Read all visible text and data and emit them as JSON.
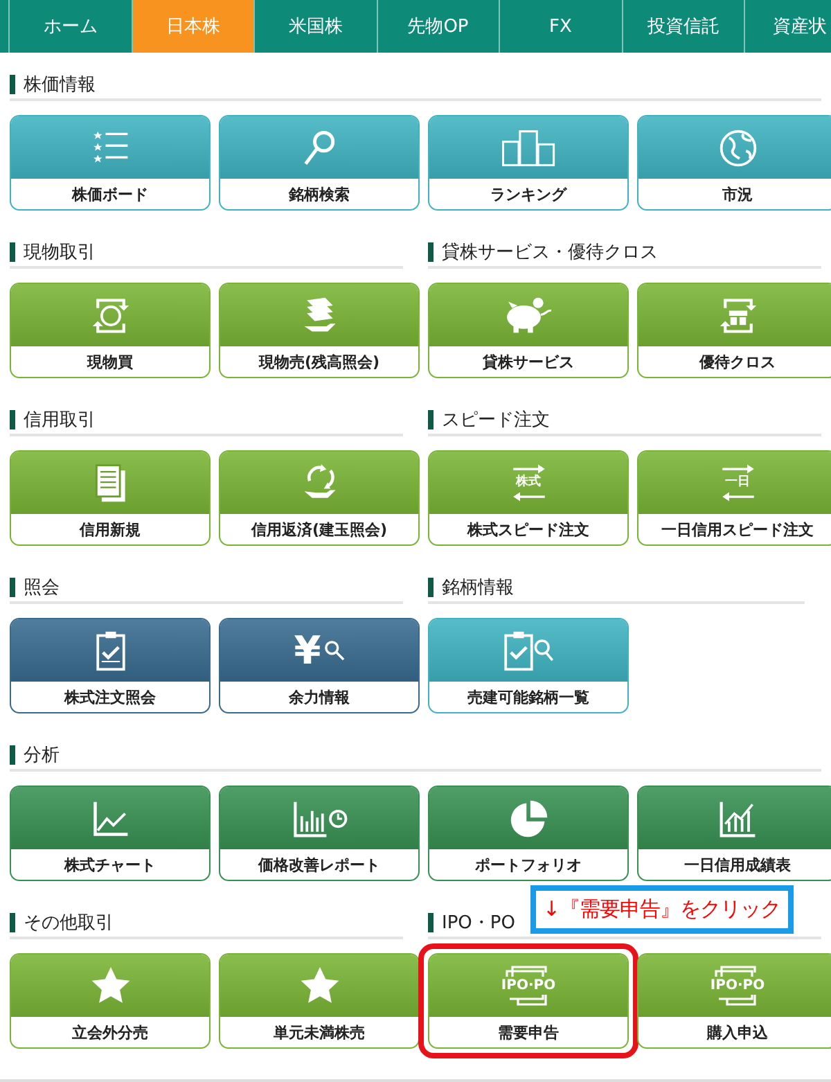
{
  "nav": {
    "tabs": [
      {
        "label": "ホーム",
        "selected": false
      },
      {
        "label": "日本株",
        "selected": true
      },
      {
        "label": "米国株",
        "selected": false
      },
      {
        "label": "先物OP",
        "selected": false
      },
      {
        "label": "FX",
        "selected": false
      },
      {
        "label": "投資信託",
        "selected": false
      },
      {
        "label": "資産状",
        "selected": false
      }
    ]
  },
  "rows": [
    {
      "sections": [
        {
          "title": "株価情報",
          "tiles": [
            {
              "label": "株価ボード",
              "color": "#3fb3c1",
              "kind": "starlist",
              "highlighted": false
            },
            {
              "label": "銘柄検索",
              "color": "#3fb3c1",
              "kind": "search",
              "highlighted": false
            },
            {
              "label": "ランキング",
              "color": "#3fb3c1",
              "kind": "podium",
              "highlighted": false
            },
            {
              "label": "市況",
              "color": "#3fb3c1",
              "kind": "globe",
              "highlighted": false
            }
          ]
        }
      ]
    },
    {
      "sections": [
        {
          "title": "現物取引",
          "tiles": [
            {
              "label": "現物買",
              "color": "#79b535",
              "kind": "cycle",
              "highlighted": false
            },
            {
              "label": "現物売(残高照会)",
              "color": "#79b535",
              "kind": "cash",
              "highlighted": false
            }
          ]
        },
        {
          "title": "貸株サービス・優待クロス",
          "tiles": [
            {
              "label": "貸株サービス",
              "color": "#79b535",
              "kind": "piggy",
              "highlighted": false
            },
            {
              "label": "優待クロス",
              "color": "#79b535",
              "kind": "gift",
              "highlighted": false
            }
          ]
        }
      ]
    },
    {
      "sections": [
        {
          "title": "信用取引",
          "tiles": [
            {
              "label": "信用新規",
              "color": "#79b535",
              "kind": "document",
              "highlighted": false
            },
            {
              "label": "信用返済(建玉照会)",
              "color": "#79b535",
              "kind": "return",
              "highlighted": false
            }
          ]
        },
        {
          "title": "スピード注文",
          "tiles": [
            {
              "label": "株式スピード注文",
              "color": "#79b535",
              "kind": "swap",
              "icon_text": "株式",
              "highlighted": false
            },
            {
              "label": "一日信用スピード注文",
              "color": "#79b535",
              "kind": "swap",
              "icon_text": "一日",
              "highlighted": false
            }
          ]
        }
      ]
    },
    {
      "sections": [
        {
          "title": "照会",
          "tiles": [
            {
              "label": "株式注文照会",
              "color": "#386b8f",
              "kind": "clipboard",
              "highlighted": false
            },
            {
              "label": "余力情報",
              "color": "#386b8f",
              "kind": "yen",
              "icon_text": "¥",
              "highlighted": false
            }
          ]
        },
        {
          "title": "銘柄情報",
          "tiles": [
            {
              "label": "売建可能銘柄一覧",
              "color": "#3fb3c1",
              "kind": "clipsearch",
              "highlighted": false
            }
          ]
        }
      ]
    },
    {
      "sections": [
        {
          "title": "分析",
          "tiles": [
            {
              "label": "株式チャート",
              "color": "#379152",
              "kind": "line",
              "highlighted": false
            },
            {
              "label": "価格改善レポート",
              "color": "#379152",
              "kind": "barclock",
              "highlighted": false
            },
            {
              "label": "ポートフォリオ",
              "color": "#379152",
              "kind": "pie",
              "highlighted": false
            },
            {
              "label": "一日信用成績表",
              "color": "#379152",
              "kind": "barup",
              "highlighted": false
            }
          ]
        }
      ]
    },
    {
      "sections": [
        {
          "title": "その他取引",
          "tiles": [
            {
              "label": "立会外分売",
              "color": "#79b535",
              "kind": "star",
              "highlighted": false
            },
            {
              "label": "単元未満株売",
              "color": "#79b535",
              "kind": "star",
              "highlighted": false
            }
          ]
        },
        {
          "title": "IPO・PO",
          "callout": "↓『需要申告』をクリック",
          "tiles": [
            {
              "label": "需要申告",
              "color": "#79b535",
              "kind": "ipo",
              "icon_text": "IPO·PO",
              "highlighted": true
            },
            {
              "label": "購入申込",
              "color": "#79b535",
              "kind": "ipo",
              "icon_text": "IPO·PO",
              "highlighted": false
            }
          ]
        }
      ]
    }
  ]
}
